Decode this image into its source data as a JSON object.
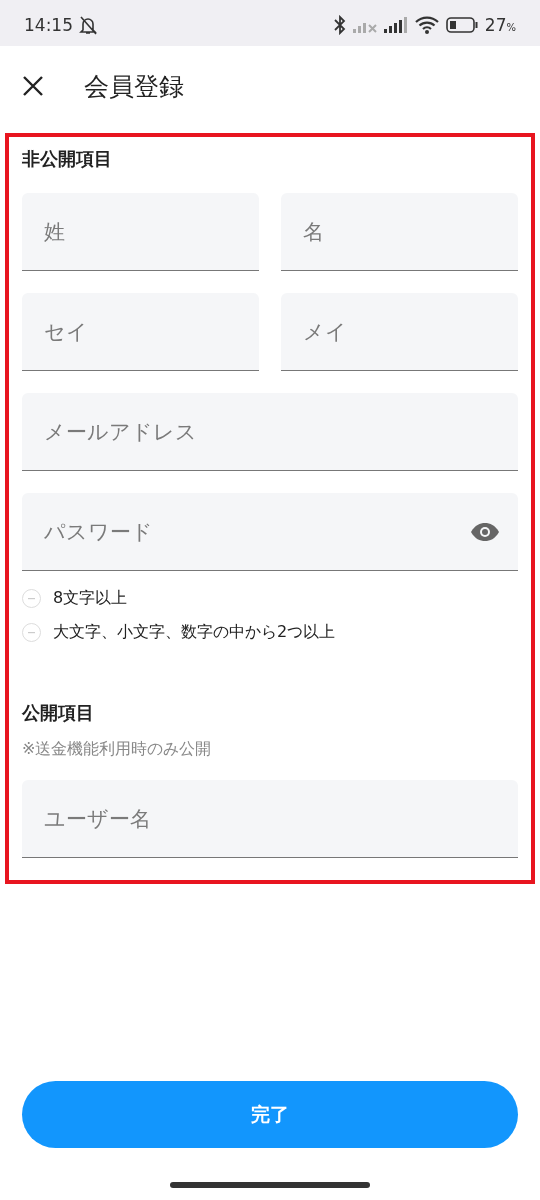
{
  "status_bar": {
    "time": "14:15",
    "battery": "27",
    "battery_unit": "%"
  },
  "header": {
    "title": "会員登録"
  },
  "private_section": {
    "title": "非公開項目",
    "name_fields": [
      {
        "placeholder": "姓"
      },
      {
        "placeholder": "名"
      }
    ],
    "kana_fields": [
      {
        "placeholder": "セイ"
      },
      {
        "placeholder": "メイ"
      }
    ],
    "email_field": {
      "placeholder": "メールアドレス"
    },
    "password_field": {
      "placeholder": "パスワード"
    },
    "password_rules": [
      {
        "text": "8文字以上",
        "met": false
      },
      {
        "text": "大文字、小文字、数字の中から2つ以上",
        "met": false
      }
    ]
  },
  "public_section": {
    "title": "公開項目",
    "note": "※送金機能利用時のみ公開",
    "username_field": {
      "placeholder": "ユーザー名"
    }
  },
  "submit_button": {
    "label": "完了"
  }
}
